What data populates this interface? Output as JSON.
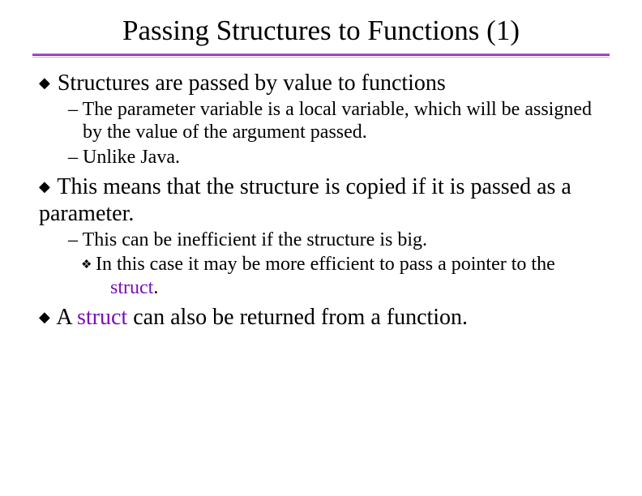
{
  "title": "Passing Structures to Functions (1)",
  "bullets": {
    "b1": {
      "text": "Structures are passed by value to functions",
      "sub": {
        "s1": "The parameter variable is a local variable, which will be assigned by the value of the argument passed.",
        "s2": "Unlike Java."
      }
    },
    "b2": {
      "text": "This means that the structure is copied if it is passed as a parameter.",
      "sub": {
        "s1": "This can be inefficient if the structure is big.",
        "ss1_a": "In this case it may be more efficient to pass a pointer to the ",
        "ss1_kw": "struct",
        "ss1_b": "."
      }
    },
    "b3_a": "A ",
    "b3_kw": "struct",
    "b3_b": " can also be returned from a function."
  },
  "punct": {
    "dash": "– ",
    "diamond": "❖"
  }
}
